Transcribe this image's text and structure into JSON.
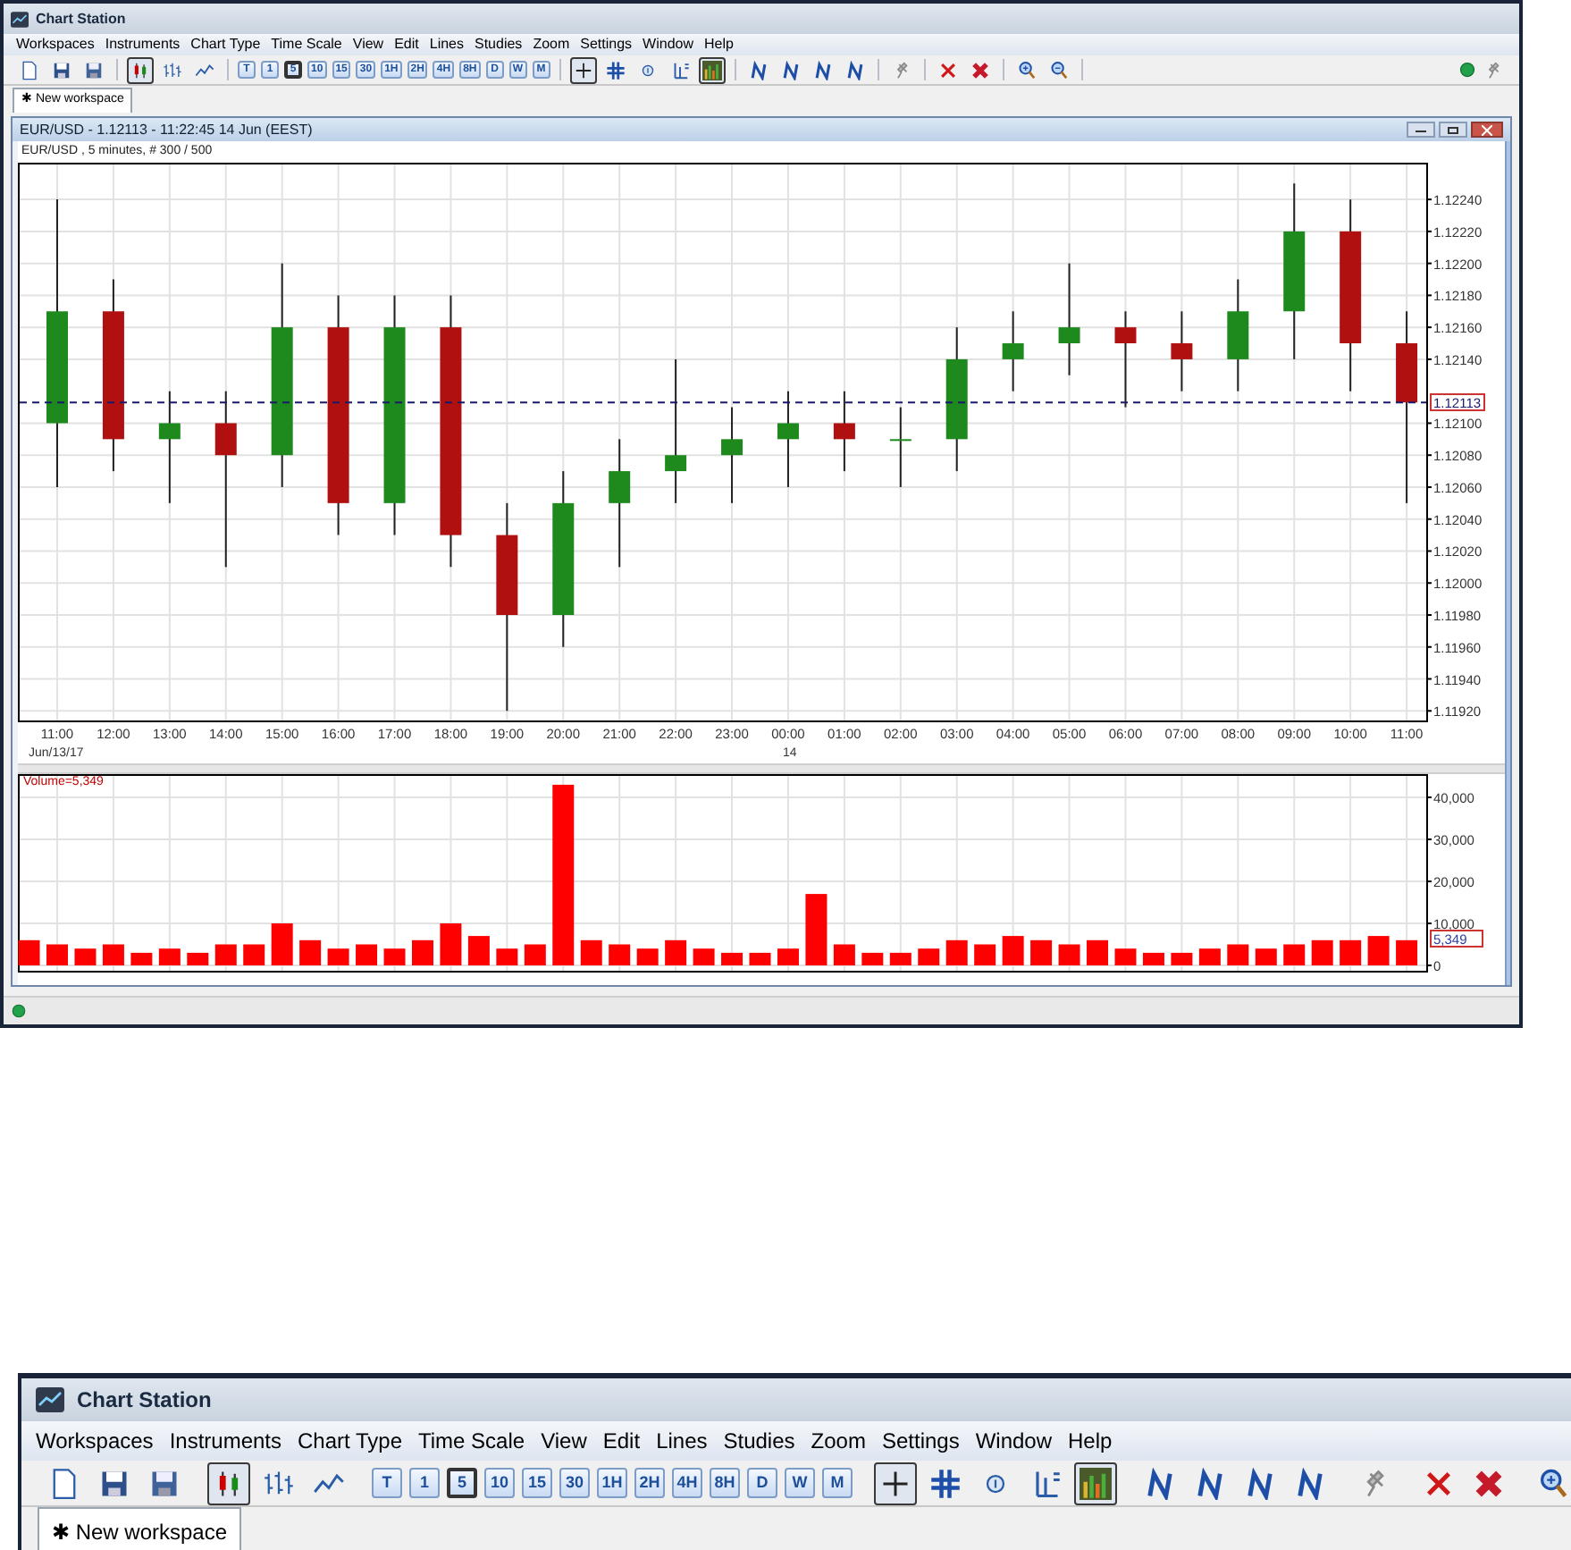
{
  "main_window": {
    "title": "Chart Station",
    "menu": [
      "Workspaces",
      "Instruments",
      "Chart Type",
      "Time Scale",
      "View",
      "Edit",
      "Lines",
      "Studies",
      "Zoom",
      "Settings",
      "Window",
      "Help"
    ],
    "chart_types": [
      {
        "kind": "candles",
        "selected": true
      },
      {
        "kind": "bars",
        "selected": false
      },
      {
        "kind": "line",
        "selected": false
      }
    ],
    "timeframes": [
      {
        "label": "T",
        "selected": false
      },
      {
        "label": "1",
        "selected": false
      },
      {
        "label": "5",
        "selected": true
      },
      {
        "label": "10",
        "selected": false
      },
      {
        "label": "15",
        "selected": false
      },
      {
        "label": "30",
        "selected": false
      },
      {
        "label": "1H",
        "selected": false
      },
      {
        "label": "2H",
        "selected": false
      },
      {
        "label": "4H",
        "selected": false
      },
      {
        "label": "8H",
        "selected": false
      },
      {
        "label": "D",
        "selected": false
      },
      {
        "label": "W",
        "selected": false
      },
      {
        "label": "M",
        "selected": false
      }
    ],
    "tools": [
      {
        "kind": "crosshair",
        "selected": true
      },
      {
        "kind": "grid",
        "selected": false
      },
      {
        "kind": "info",
        "selected": false
      },
      {
        "kind": "levels",
        "selected": false
      },
      {
        "kind": "volume",
        "selected": true
      }
    ],
    "tab": {
      "label": "✱ New workspace",
      "selected": true
    },
    "chart_window": {
      "title": "EUR/USD - 1.12113 - 11:22:45 14 Jun (EEST)",
      "subtitle": "EUR/USD , 5 minutes, # 300 / 500",
      "price_chart": {
        "date_labels": [
          "Jun/13/17",
          "14"
        ],
        "chart_data": {
          "type": "candlestick",
          "grid": true,
          "ylim": [
            1.11914,
            1.12263
          ],
          "categories": [
            "11:00",
            "12:00",
            "13:00",
            "14:00",
            "15:00",
            "16:00",
            "17:00",
            "18:00",
            "19:00",
            "20:00",
            "21:00",
            "22:00",
            "23:00",
            "00:00",
            "01:00",
            "02:00",
            "03:00",
            "04:00",
            "05:00",
            "06:00",
            "07:00",
            "08:00",
            "09:00",
            "10:00",
            "11:00"
          ],
          "ohlc": [
            [
              1.121,
              1.1224,
              1.1206,
              1.1217
            ],
            [
              1.1217,
              1.1219,
              1.1207,
              1.1209
            ],
            [
              1.1209,
              1.1212,
              1.1205,
              1.121
            ],
            [
              1.121,
              1.1212,
              1.1201,
              1.1208
            ],
            [
              1.1208,
              1.122,
              1.1206,
              1.1216
            ],
            [
              1.1216,
              1.1218,
              1.1203,
              1.1205
            ],
            [
              1.1205,
              1.1218,
              1.1203,
              1.1216
            ],
            [
              1.1216,
              1.1218,
              1.1201,
              1.1203
            ],
            [
              1.1203,
              1.1205,
              1.1192,
              1.1198
            ],
            [
              1.1198,
              1.1207,
              1.1196,
              1.1205
            ],
            [
              1.1205,
              1.1209,
              1.1201,
              1.1207
            ],
            [
              1.1207,
              1.1214,
              1.1205,
              1.1208
            ],
            [
              1.1208,
              1.1211,
              1.1205,
              1.1209
            ],
            [
              1.1209,
              1.1212,
              1.1206,
              1.121
            ],
            [
              1.121,
              1.1212,
              1.1207,
              1.1209
            ],
            [
              1.1209,
              1.1211,
              1.1206,
              1.1209
            ],
            [
              1.1209,
              1.1216,
              1.1207,
              1.1214
            ],
            [
              1.1214,
              1.1217,
              1.1212,
              1.1215
            ],
            [
              1.1215,
              1.122,
              1.1213,
              1.1216
            ],
            [
              1.1216,
              1.1217,
              1.1211,
              1.1215
            ],
            [
              1.1215,
              1.1217,
              1.1212,
              1.1214
            ],
            [
              1.1214,
              1.1219,
              1.1212,
              1.1217
            ],
            [
              1.1217,
              1.1225,
              1.1214,
              1.1222
            ],
            [
              1.1222,
              1.1224,
              1.1212,
              1.1215
            ],
            [
              1.1215,
              1.1217,
              1.1205,
              1.12113
            ]
          ],
          "yticks": [
            {
              "value": 1.1224,
              "label": "1.12240"
            },
            {
              "value": 1.1222,
              "label": "1.12220"
            },
            {
              "value": 1.122,
              "label": "1.12200"
            },
            {
              "value": 1.1218,
              "label": "1.12180"
            },
            {
              "value": 1.1216,
              "label": "1.12160"
            },
            {
              "value": 1.1214,
              "label": "1.12140"
            },
            {
              "value": 1.121,
              "label": "1.12100"
            },
            {
              "value": 1.1208,
              "label": "1.12080"
            },
            {
              "value": 1.1206,
              "label": "1.12060"
            },
            {
              "value": 1.1204,
              "label": "1.12040"
            },
            {
              "value": 1.1202,
              "label": "1.12020"
            },
            {
              "value": 1.12,
              "label": "1.12000"
            },
            {
              "value": 1.1198,
              "label": "1.11980"
            },
            {
              "value": 1.1196,
              "label": "1.11960"
            },
            {
              "value": 1.1194,
              "label": "1.11940"
            },
            {
              "value": 1.1192,
              "label": "1.11920"
            }
          ],
          "ref_lines": [
            {
              "axis": "y",
              "value": 1.12113,
              "label": "1.12113",
              "color": "#1a1a6a"
            }
          ]
        }
      },
      "volume_chart": {
        "legend": "Volume=5,349",
        "last_value": "5,349",
        "chart_data": {
          "type": "bar",
          "grid": true,
          "ylim": [
            -1277,
            45532
          ],
          "series": [
            {
              "color": "#ff0000",
              "values": [
                6000,
                5000,
                4000,
                5000,
                3000,
                4000,
                3000,
                5000,
                5000,
                10000,
                6000,
                4000,
                5000,
                4000,
                6000,
                10000,
                7000,
                4000,
                5000,
                43000,
                6000,
                5000,
                4000,
                6000,
                4000,
                3000,
                3000,
                4000,
                17000,
                5000,
                3000,
                3000,
                4000,
                6000,
                5000,
                7000,
                6000,
                5000,
                6000,
                4000,
                3000,
                3000,
                4000,
                5000,
                4000,
                5000,
                6000,
                6000,
                7000,
                6000
              ]
            }
          ],
          "yticks": [
            {
              "value": 0,
              "label": "0"
            },
            {
              "value": 10000,
              "label": "10,000"
            },
            {
              "value": 20000,
              "label": "20,000"
            },
            {
              "value": 30000,
              "label": "30,000"
            },
            {
              "value": 40000,
              "label": "40,000"
            }
          ]
        }
      }
    }
  },
  "zoomed_strip": {
    "title": "Chart Station",
    "menu": [
      "Workspaces",
      "Instruments",
      "Chart Type",
      "Time Scale",
      "View",
      "Edit",
      "Lines",
      "Studies",
      "Zoom",
      "Settings",
      "Window",
      "Help"
    ],
    "chart_types": [
      {
        "kind": "candles",
        "selected": true
      },
      {
        "kind": "bars",
        "selected": false
      },
      {
        "kind": "line",
        "selected": false
      }
    ],
    "timeframes": [
      {
        "label": "T",
        "selected": false
      },
      {
        "label": "1",
        "selected": false
      },
      {
        "label": "5",
        "selected": true
      },
      {
        "label": "10",
        "selected": false
      },
      {
        "label": "15",
        "selected": false
      },
      {
        "label": "30",
        "selected": false
      },
      {
        "label": "1H",
        "selected": false
      },
      {
        "label": "2H",
        "selected": false
      },
      {
        "label": "4H",
        "selected": false
      },
      {
        "label": "8H",
        "selected": false
      },
      {
        "label": "D",
        "selected": false
      },
      {
        "label": "W",
        "selected": false
      },
      {
        "label": "M",
        "selected": false
      }
    ],
    "tools": [
      {
        "kind": "crosshair",
        "selected": true
      },
      {
        "kind": "grid",
        "selected": false
      },
      {
        "kind": "info",
        "selected": false
      },
      {
        "kind": "levels",
        "selected": false
      },
      {
        "kind": "volume",
        "selected": true
      }
    ],
    "tab": {
      "label": "✱ New workspace",
      "selected": true
    }
  }
}
